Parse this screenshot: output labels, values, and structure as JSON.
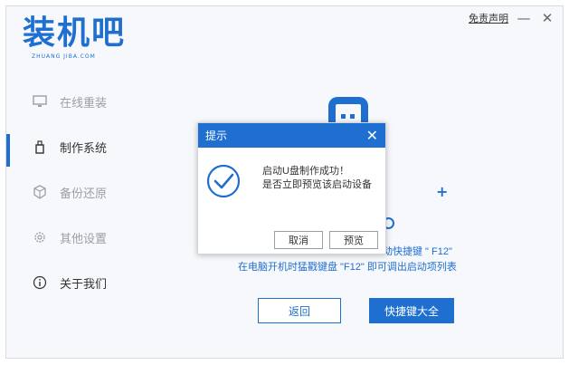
{
  "brand": {
    "name": "装机吧",
    "subtitle": "ZHUANG JIBA.COM"
  },
  "topbar": {
    "disclaimer": "免责声明",
    "minimize": "—",
    "close": "✕"
  },
  "sidebar": {
    "items": [
      {
        "label": "在线重装",
        "icon": "monitor-icon"
      },
      {
        "label": "制作系统",
        "icon": "usb-drive-icon"
      },
      {
        "label": "备份还原",
        "icon": "cube-icon"
      },
      {
        "label": "其他设置",
        "icon": "gear-icon"
      },
      {
        "label": "关于我们",
        "icon": "info-icon"
      }
    ]
  },
  "main": {
    "hint_line1": "动快捷键 \" F12\"",
    "hint_line2": "在电脑开机时猛戳键盘 \"F12\" 即可调出启动项列表",
    "back_label": "返回",
    "hotkeys_label": "快捷键大全"
  },
  "dialog": {
    "title": "提示",
    "close": "✕",
    "message_line1": "启动U盘制作成功！",
    "message_line2": "是否立即预览该启动设备",
    "cancel_label": "取消",
    "preview_label": "预览"
  },
  "colors": {
    "accent": "#1f6fd0"
  }
}
